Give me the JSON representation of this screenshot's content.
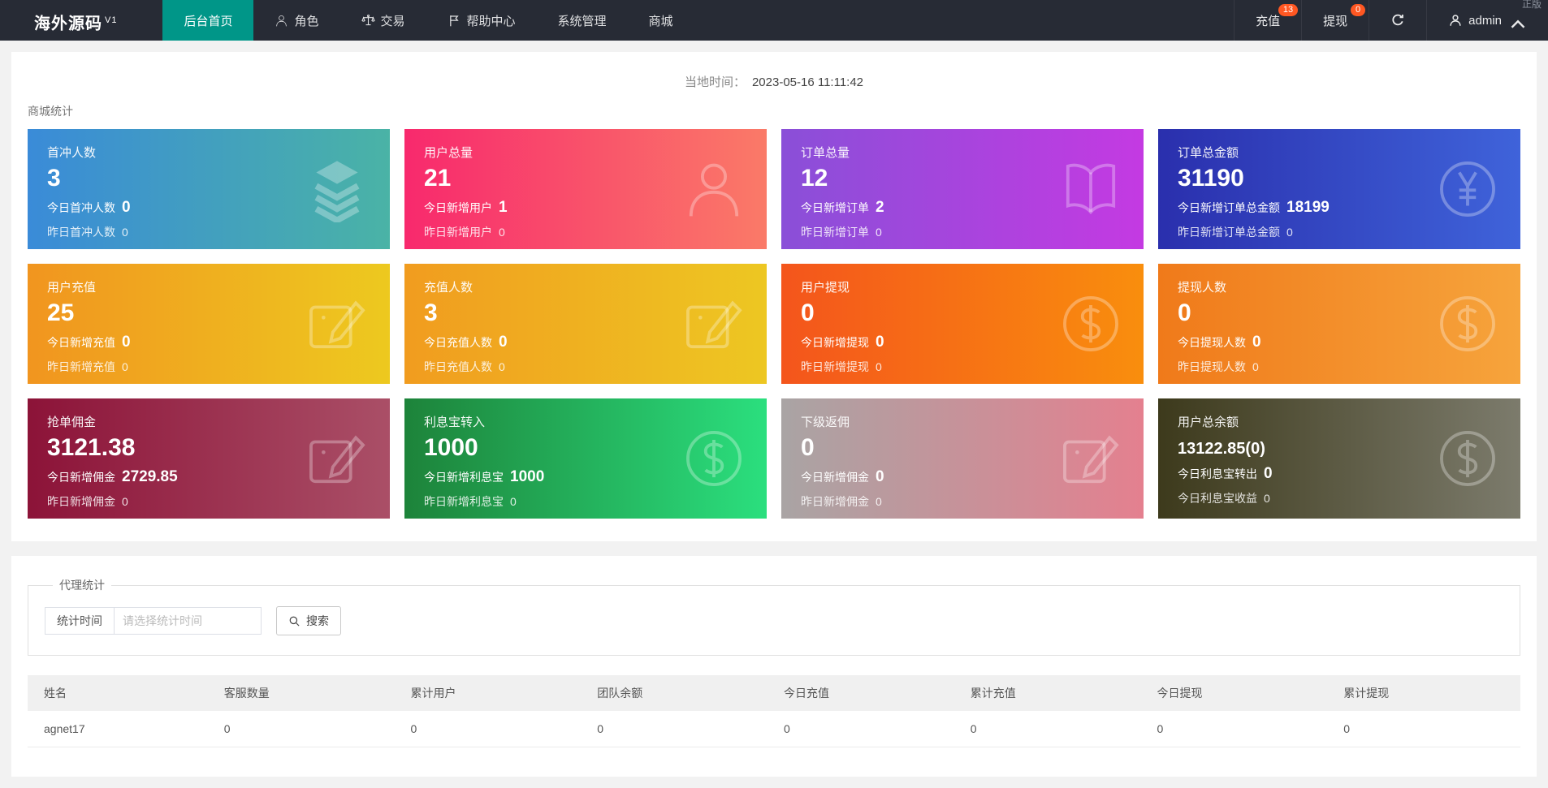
{
  "theme": {
    "navbar_bg": "#272b35",
    "accent_green": "#009688",
    "badge_orange": "#ff5722",
    "page_bg": "#f2f2f2"
  },
  "navbar": {
    "brand": "海外源码",
    "brand_sup": "V1",
    "watermark": "正版",
    "items": [
      {
        "key": "home",
        "label": "后台首页",
        "icon": "",
        "active": true
      },
      {
        "key": "roles",
        "label": "角色",
        "icon": "person",
        "active": false
      },
      {
        "key": "trade",
        "label": "交易",
        "icon": "scales",
        "active": false
      },
      {
        "key": "help",
        "label": "帮助中心",
        "icon": "flag",
        "active": false
      },
      {
        "key": "system",
        "label": "系统管理",
        "icon": "",
        "active": false
      },
      {
        "key": "mall",
        "label": "商城",
        "icon": "",
        "active": false
      }
    ],
    "recharge": {
      "label": "充值",
      "badge": "13"
    },
    "withdraw": {
      "label": "提现",
      "badge": "0"
    },
    "user": "admin"
  },
  "main": {
    "local_time_label": "当地时间：",
    "local_time_value": "2023-05-16 11:11:42",
    "section_title": "商城统计",
    "cards": [
      {
        "key": "first-charge-users",
        "title": "首冲人数",
        "value": "3",
        "line2_label": "今日首冲人数",
        "line2_value": "0",
        "line3_label": "昨日首冲人数",
        "line3_value": "0",
        "icon": "layers",
        "gradient": [
          "#3a8bd8",
          "#4ab3a6"
        ],
        "compact": false
      },
      {
        "key": "total-users",
        "title": "用户总量",
        "value": "21",
        "line2_label": "今日新增用户",
        "line2_value": "1",
        "line3_label": "昨日新增用户",
        "line3_value": "0",
        "icon": "person",
        "gradient": [
          "#f8296d",
          "#fa7a68"
        ],
        "compact": false
      },
      {
        "key": "total-orders",
        "title": "订单总量",
        "value": "12",
        "line2_label": "今日新增订单",
        "line2_value": "2",
        "line3_label": "昨日新增订单",
        "line3_value": "0",
        "icon": "book",
        "gradient": [
          "#8a4fd8",
          "#c43ae2"
        ],
        "compact": false
      },
      {
        "key": "total-order-amount",
        "title": "订单总金额",
        "value": "31190",
        "line2_label": "今日新增订单总金额",
        "line2_value": "18199",
        "line3_label": "昨日新增订单总金额",
        "line3_value": "0",
        "icon": "yen",
        "gradient": [
          "#2a2fad",
          "#3f63da"
        ],
        "compact": false
      },
      {
        "key": "user-recharge",
        "title": "用户充值",
        "value": "25",
        "line2_label": "今日新增充值",
        "line2_value": "0",
        "line3_label": "昨日新增充值",
        "line3_value": "0",
        "icon": "edit",
        "gradient": [
          "#f1951f",
          "#edc91f"
        ],
        "compact": false
      },
      {
        "key": "recharge-users",
        "title": "充值人数",
        "value": "3",
        "line2_label": "今日充值人数",
        "line2_value": "0",
        "line3_label": "昨日充值人数",
        "line3_value": "0",
        "icon": "edit",
        "gradient": [
          "#f19c1f",
          "#edc722"
        ],
        "compact": false
      },
      {
        "key": "user-withdraw",
        "title": "用户提现",
        "value": "0",
        "line2_label": "今日新增提现",
        "line2_value": "0",
        "line3_label": "昨日新增提现",
        "line3_value": "0",
        "icon": "dollar",
        "gradient": [
          "#f4551c",
          "#f98e0d"
        ],
        "compact": false
      },
      {
        "key": "withdraw-users",
        "title": "提现人数",
        "value": "0",
        "line2_label": "今日提现人数",
        "line2_value": "0",
        "line3_label": "昨日提现人数",
        "line3_value": "0",
        "icon": "dollar",
        "gradient": [
          "#f07a1a",
          "#f6a43c"
        ],
        "compact": false
      },
      {
        "key": "order-commission",
        "title": "抢单佣金",
        "value": "3121.38",
        "line2_label": "今日新增佣金",
        "line2_value": "2729.85",
        "line3_label": "昨日新增佣金",
        "line3_value": "0",
        "icon": "edit",
        "gradient": [
          "#8c1338",
          "#aa4f67"
        ],
        "compact": false
      },
      {
        "key": "interest-transfer-in",
        "title": "利息宝转入",
        "value": "1000",
        "line2_label": "今日新增利息宝",
        "line2_value": "1000",
        "line3_label": "昨日新增利息宝",
        "line3_value": "0",
        "icon": "dollar",
        "gradient": [
          "#1d833a",
          "#2bdf7e"
        ],
        "compact": false
      },
      {
        "key": "sub-rebate",
        "title": "下级返佣",
        "value": "0",
        "line2_label": "今日新增佣金",
        "line2_value": "0",
        "line3_label": "昨日新增佣金",
        "line3_value": "0",
        "icon": "edit",
        "gradient": [
          "#a9a4a4",
          "#e4808f"
        ],
        "compact": false
      },
      {
        "key": "user-total-balance",
        "title": "用户总余额",
        "value": "13122.85(0)",
        "line2_label": "今日利息宝转出",
        "line2_value": "0",
        "line3_label": "今日利息宝收益",
        "line3_value": "0",
        "icon": "dollar",
        "gradient": [
          "#3d3a1c",
          "#7c7b6c"
        ],
        "compact": true
      }
    ]
  },
  "agent": {
    "legend": "代理统计",
    "filter_label": "统计时间",
    "filter_placeholder": "请选择统计时间",
    "search_label": "搜索",
    "table": {
      "headers": [
        "姓名",
        "客服数量",
        "累计用户",
        "团队余额",
        "今日充值",
        "累计充值",
        "今日提现",
        "累计提现"
      ],
      "rows": [
        [
          "agnet17",
          "0",
          "0",
          "0",
          "0",
          "0",
          "0",
          "0"
        ]
      ]
    }
  }
}
